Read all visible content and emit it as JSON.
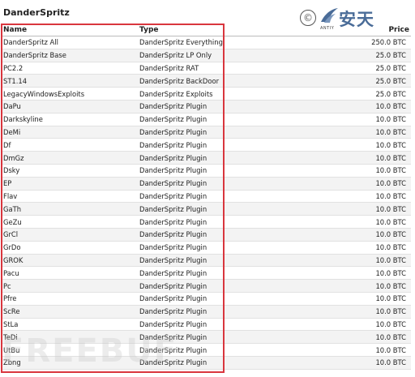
{
  "title": "DanderSpritz",
  "logo": {
    "symbol": "©",
    "brand_cn": "安天",
    "brand_en": "ANTIY"
  },
  "table": {
    "headers": {
      "name": "Name",
      "type": "Type",
      "price": "Price"
    },
    "rows": [
      {
        "name": "DanderSpritz All",
        "type": "DanderSpritz Everything",
        "price": "250.0 BTC"
      },
      {
        "name": "DanderSpritz Base",
        "type": "DanderSpritz LP Only",
        "price": "25.0 BTC"
      },
      {
        "name": "PC2.2",
        "type": "DanderSpritz RAT",
        "price": "25.0 BTC"
      },
      {
        "name": "ST1.14",
        "type": "DanderSpritz BackDoor",
        "price": "25.0 BTC"
      },
      {
        "name": "LegacyWindowsExploits",
        "type": "DanderSpritz Exploits",
        "price": "25.0 BTC"
      },
      {
        "name": "DaPu",
        "type": "DanderSpritz Plugin",
        "price": "10.0 BTC"
      },
      {
        "name": "Darkskyline",
        "type": "DanderSpritz Plugin",
        "price": "10.0 BTC"
      },
      {
        "name": "DeMi",
        "type": "DanderSpritz Plugin",
        "price": "10.0 BTC"
      },
      {
        "name": "Df",
        "type": "DanderSpritz Plugin",
        "price": "10.0 BTC"
      },
      {
        "name": "DmGz",
        "type": "DanderSpritz Plugin",
        "price": "10.0 BTC"
      },
      {
        "name": "Dsky",
        "type": "DanderSpritz Plugin",
        "price": "10.0 BTC"
      },
      {
        "name": "EP",
        "type": "DanderSpritz Plugin",
        "price": "10.0 BTC"
      },
      {
        "name": "Flav",
        "type": "DanderSpritz Plugin",
        "price": "10.0 BTC"
      },
      {
        "name": "GaTh",
        "type": "DanderSpritz Plugin",
        "price": "10.0 BTC"
      },
      {
        "name": "GeZu",
        "type": "DanderSpritz Plugin",
        "price": "10.0 BTC"
      },
      {
        "name": "GrCl",
        "type": "DanderSpritz Plugin",
        "price": "10.0 BTC"
      },
      {
        "name": "GrDo",
        "type": "DanderSpritz Plugin",
        "price": "10.0 BTC"
      },
      {
        "name": "GROK",
        "type": "DanderSpritz Plugin",
        "price": "10.0 BTC"
      },
      {
        "name": "Pacu",
        "type": "DanderSpritz Plugin",
        "price": "10.0 BTC"
      },
      {
        "name": "Pc",
        "type": "DanderSpritz Plugin",
        "price": "10.0 BTC"
      },
      {
        "name": "Pfre",
        "type": "DanderSpritz Plugin",
        "price": "10.0 BTC"
      },
      {
        "name": "ScRe",
        "type": "DanderSpritz Plugin",
        "price": "10.0 BTC"
      },
      {
        "name": "StLa",
        "type": "DanderSpritz Plugin",
        "price": "10.0 BTC"
      },
      {
        "name": "TeDi",
        "type": "DanderSpritz Plugin",
        "price": "10.0 BTC"
      },
      {
        "name": "UtBu",
        "type": "DanderSpritz Plugin",
        "price": "10.0 BTC"
      },
      {
        "name": "Zbng",
        "type": "DanderSpritz Plugin",
        "price": "10.0 BTC"
      }
    ]
  },
  "watermark": "FREEBUF",
  "colors": {
    "highlight_border": "#d9363e",
    "brand_blue": "#4a6c98"
  }
}
